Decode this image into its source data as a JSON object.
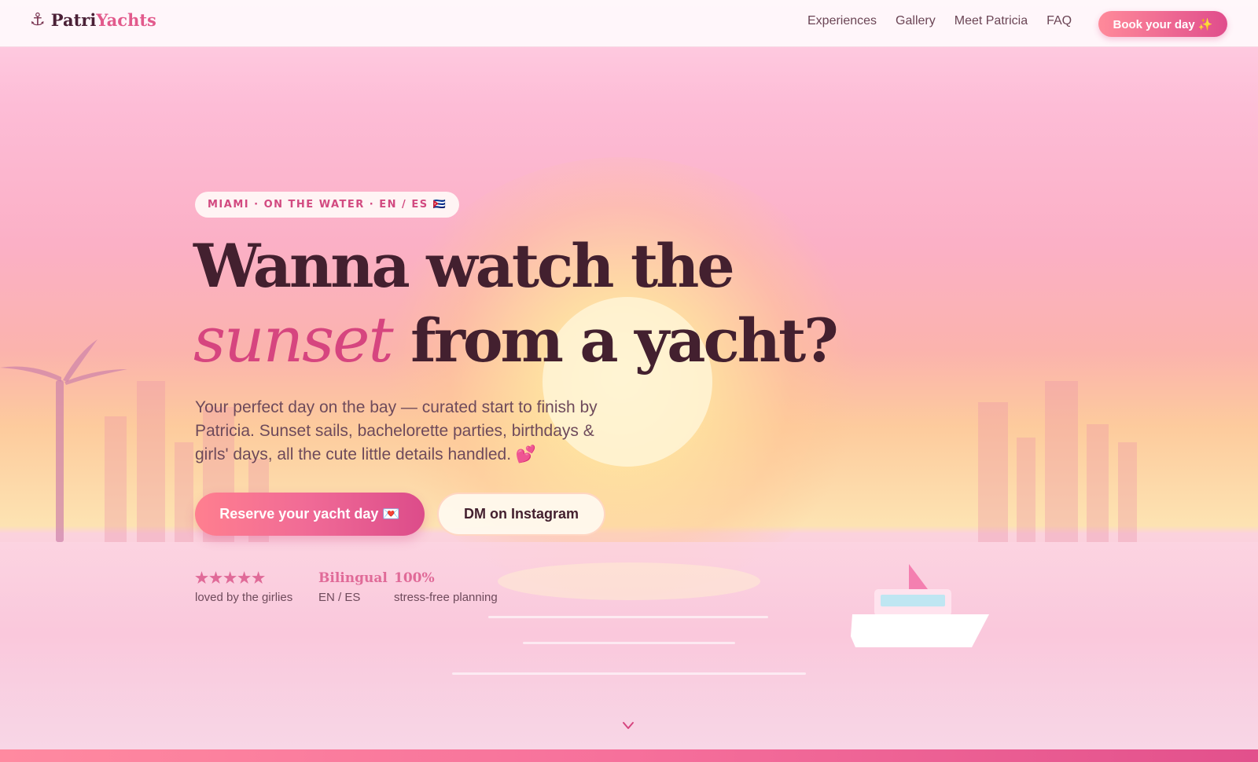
{
  "brand": {
    "icon": "anchor-icon",
    "name_plain": "Patri",
    "name_accent": "Yachts"
  },
  "nav": {
    "links": [
      "Experiences",
      "Gallery",
      "Meet Patricia",
      "FAQ"
    ],
    "cta": "Book your day ✨"
  },
  "hero": {
    "tag": "MIAMI · ON THE WATER · EN / ES 🇨🇺",
    "headline_line1": "Wanna watch the",
    "headline_accent": "sunset",
    "headline_line2_rest": "from a yacht?",
    "subtitle": "Your perfect day on the bay — curated start to finish by Patricia. Sunset sails, bachelorette parties, birthdays & girls' days, all the cute little details handled. 💕",
    "primary_cta": "Reserve your yacht day 💌",
    "secondary_cta": "DM on Instagram"
  },
  "stats": [
    {
      "top": "★★★★★",
      "bottom": "loved by the girlies"
    },
    {
      "top": "Bilingual",
      "bottom": "EN / ES"
    },
    {
      "top": "100%",
      "bottom": "stress-free planning"
    }
  ],
  "colors": {
    "accent": "#e25a8c",
    "heading": "#43202f",
    "cta_gradient_start": "#ff8a9a",
    "cta_gradient_end": "#e04d8c"
  },
  "scroll_icon": "chevron-down-icon"
}
